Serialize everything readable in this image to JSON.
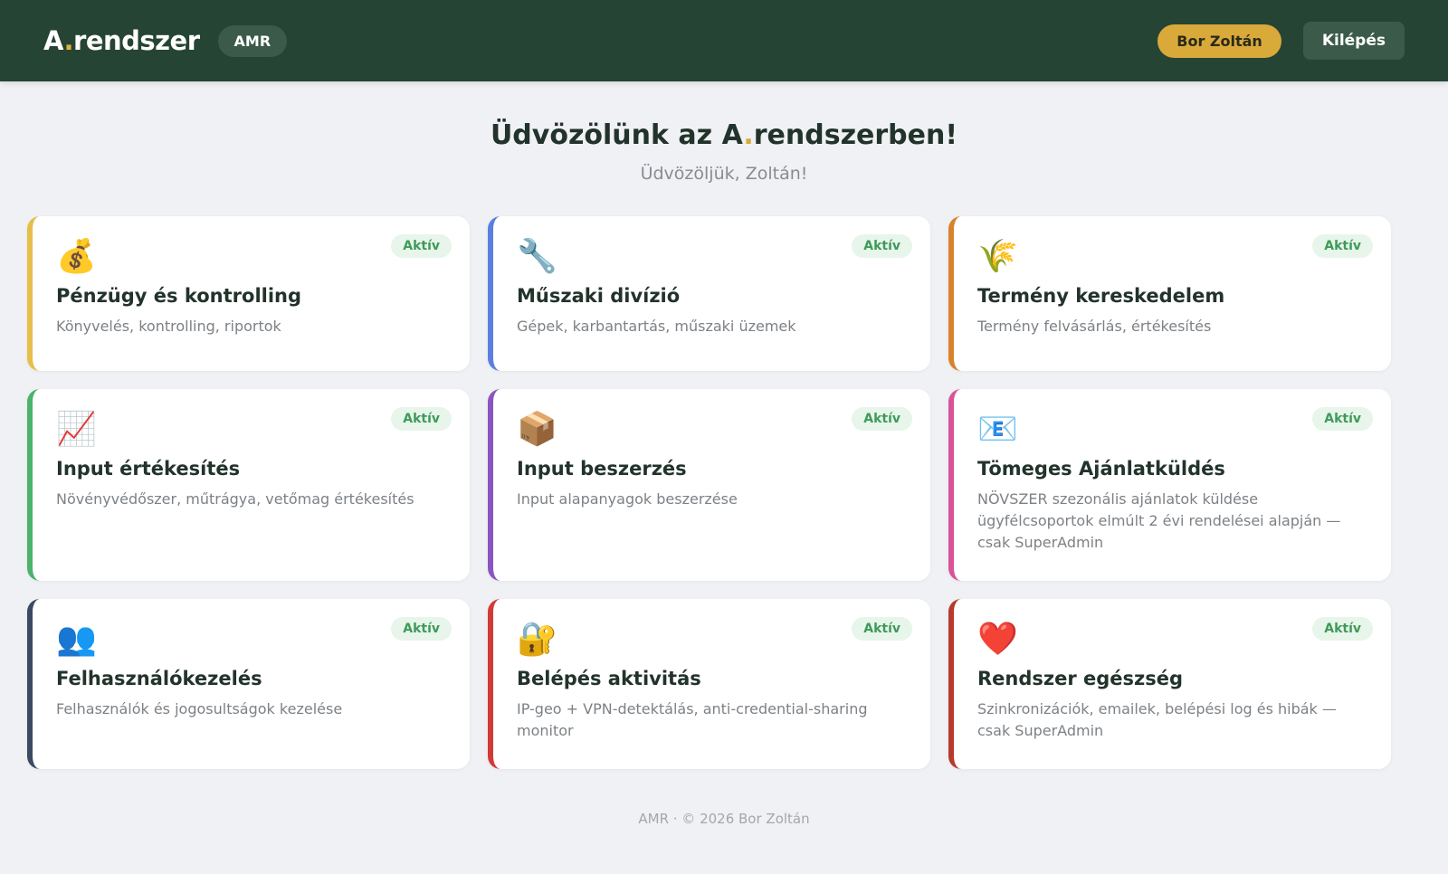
{
  "header": {
    "logo_a": "A",
    "logo_dot": ".",
    "logo_rest": "rendszer",
    "app_badge": "AMR",
    "user_name": "Bor Zoltán",
    "logout_label": "Kilépés"
  },
  "hero": {
    "title_prefix": "Üdvözölünk az ",
    "title_a": "A",
    "title_dot": ".",
    "title_rest": "rendszerben!",
    "subtitle": "Üdvözöljük, Zoltán!"
  },
  "colors": {
    "header_bg": "#264434",
    "accent_gold": "#d9a93a",
    "status_green": "#3f9a5a"
  },
  "modules": [
    {
      "icon": "💰",
      "icon_name": "money-bag-icon",
      "title": "Pénzügy és kontrolling",
      "desc": "Könyvelés, kontrolling, riportok",
      "status": "Aktív",
      "accent": "#e6bf4a"
    },
    {
      "icon": "🔧",
      "icon_name": "wrench-icon",
      "title": "Műszaki divízió",
      "desc": "Gépek, karbantartás, műszaki üzemek",
      "status": "Aktív",
      "accent": "#5a7fe0"
    },
    {
      "icon": "🌾",
      "icon_name": "wheat-icon",
      "title": "Termény kereskedelem",
      "desc": "Termény felvásárlás, értékesítés",
      "status": "Aktív",
      "accent": "#d9822b"
    },
    {
      "icon": "📈",
      "icon_name": "chart-up-icon",
      "title": "Input értékesítés",
      "desc": "Növényvédőszer, műtrágya, vetőmag értékesítés",
      "status": "Aktív",
      "accent": "#4bb36b"
    },
    {
      "icon": "📦",
      "icon_name": "package-icon",
      "title": "Input beszerzés",
      "desc": "Input alapanyagok beszerzése",
      "status": "Aktív",
      "accent": "#8a55c0"
    },
    {
      "icon": "📧",
      "icon_name": "email-icon",
      "title": "Tömeges Ajánlatküldés",
      "desc": "NÖVSZER szezonális ajánlatok küldése ügyfélcsoportok elmúlt 2 évi rendelései alapján — csak SuperAdmin",
      "status": "Aktív",
      "accent": "#d9529b"
    },
    {
      "icon": "👥",
      "icon_name": "users-icon",
      "title": "Felhasználókezelés",
      "desc": "Felhasználók és jogosultságok kezelése",
      "status": "Aktív",
      "accent": "#3a4a63"
    },
    {
      "icon": "🔐",
      "icon_name": "lock-key-icon",
      "title": "Belépés aktivitás",
      "desc": "IP-geo + VPN-detektálás, anti-credential-sharing monitor",
      "status": "Aktív",
      "accent": "#d23a35"
    },
    {
      "icon": "❤️",
      "icon_name": "heart-icon",
      "title": "Rendszer egészség",
      "desc": "Szinkronizációk, emailek, belépési log és hibák — csak SuperAdmin",
      "status": "Aktív",
      "accent": "#b83a2e"
    }
  ],
  "footer": {
    "text": "AMR · © 2026 Bor Zoltán"
  }
}
